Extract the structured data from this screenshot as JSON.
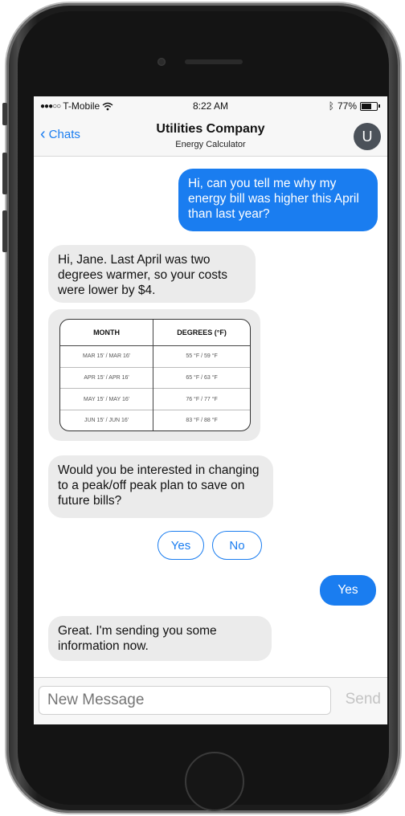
{
  "status_bar": {
    "carrier": "T-Mobile",
    "time": "8:22 AM",
    "battery": "77%",
    "battery_level": 0.77
  },
  "nav": {
    "back_label": "Chats",
    "title": "Utilities Company",
    "subtitle": "Energy Calculator",
    "avatar_initial": "U"
  },
  "messages": {
    "m1": "Hi, can you tell me why my energy bill was higher this April than last year?",
    "m2": "Hi, Jane. Last April was two degrees warmer, so your costs were lower by $4.",
    "m3": "Would you be interested in changing to a peak/off peak plan to save on future bills?",
    "m4": "Yes",
    "m5": "Great. I'm sending you some information now."
  },
  "table": {
    "headers": [
      "MONTH",
      "DEGREES (°F)"
    ],
    "rows": [
      [
        "MAR 15' / MAR 16'",
        "55 °F / 59 °F"
      ],
      [
        "APR 15' / APR 16'",
        "65 °F / 63 °F"
      ],
      [
        "MAY 15' / MAY 16'",
        "76 °F / 77 °F"
      ],
      [
        "JUN 15' / JUN 16'",
        "83 °F / 88 °F"
      ]
    ]
  },
  "quick_replies": {
    "yes": "Yes",
    "no": "No"
  },
  "composer": {
    "placeholder": "New Message",
    "send_label": "Send"
  },
  "colors": {
    "accent": "#1a7df0",
    "incoming_bubble": "#ebebeb"
  }
}
